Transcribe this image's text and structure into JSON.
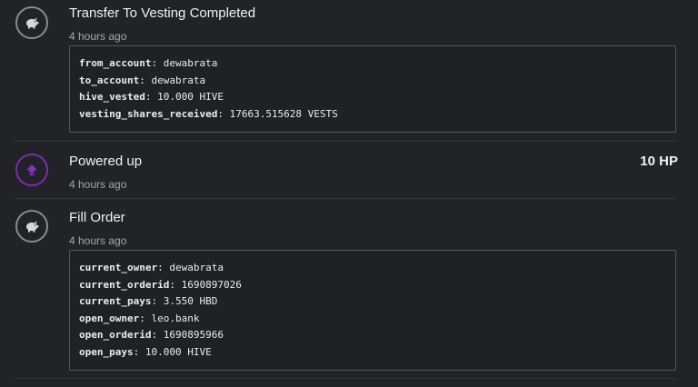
{
  "items": [
    {
      "title": "Transfer To Vesting Completed",
      "time": "4 hours ago",
      "icon": "piggy-bank-icon",
      "details": [
        {
          "key": "from_account",
          "value": "dewabrata"
        },
        {
          "key": "to_account",
          "value": "dewabrata"
        },
        {
          "key": "hive_vested",
          "value": "10.000 HIVE"
        },
        {
          "key": "vesting_shares_received",
          "value": "17663.515628 VESTS"
        }
      ]
    },
    {
      "title": "Powered up",
      "time": "4 hours ago",
      "icon": "arrow-up-icon",
      "amount": "10 HP"
    },
    {
      "title": "Fill Order",
      "time": "4 hours ago",
      "icon": "piggy-bank-icon",
      "details": [
        {
          "key": "current_owner",
          "value": "dewabrata"
        },
        {
          "key": "current_orderid",
          "value": "1690897026"
        },
        {
          "key": "current_pays",
          "value": "3.550 HBD"
        },
        {
          "key": "open_owner",
          "value": "leo.bank"
        },
        {
          "key": "open_orderid",
          "value": "1690895966"
        },
        {
          "key": "open_pays",
          "value": "10.000 HIVE"
        }
      ]
    }
  ],
  "colors": {
    "background": "#222326",
    "powerup_accent": "#7c2bb5",
    "icon_border": "#8a8b8e"
  }
}
